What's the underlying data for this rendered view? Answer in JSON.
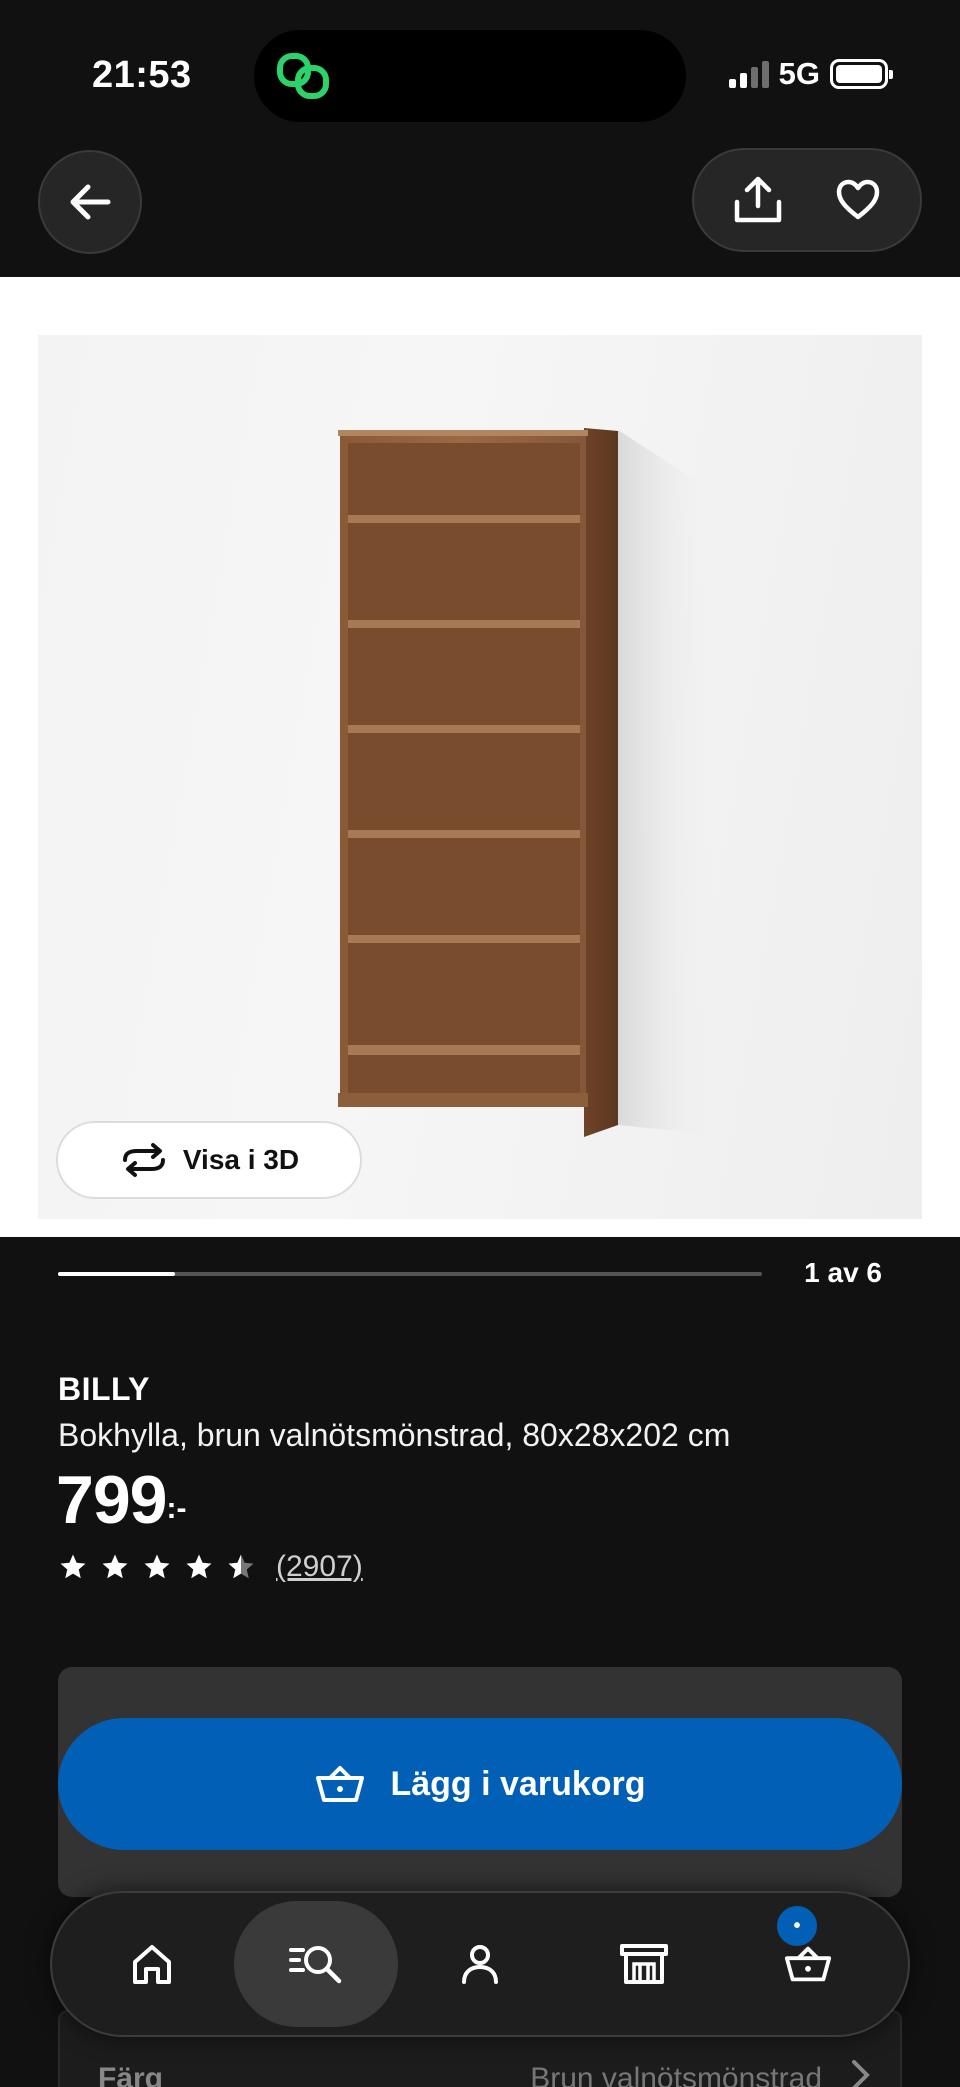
{
  "status_bar": {
    "time": "21:53",
    "network": "5G"
  },
  "header": {
    "back_icon": "arrow-left-icon",
    "share_icon": "share-icon",
    "favorite_icon": "heart-icon"
  },
  "gallery": {
    "view_3d_label": "Visa i 3D",
    "page_indicator": "1 av 6",
    "progress_fraction": 0.1667
  },
  "product": {
    "brand": "BILLY",
    "description": "Bokhylla, brun valnötsmönstrad, 80x28x202 cm",
    "price": "799",
    "price_suffix": ":-",
    "rating": 4.5,
    "review_count": "(2907)"
  },
  "cart": {
    "add_label": "Lägg i varukorg",
    "badge": "•"
  },
  "color_option": {
    "label": "Färg",
    "value": "Brun valnötsmönstrad"
  },
  "nav": {
    "items": [
      "home-icon",
      "search-icon",
      "profile-icon",
      "store-icon",
      "cart-icon"
    ],
    "active_index": 1
  },
  "colors": {
    "accent": "#0160b5",
    "background": "#111111",
    "island_icon": "#2bd46b"
  }
}
